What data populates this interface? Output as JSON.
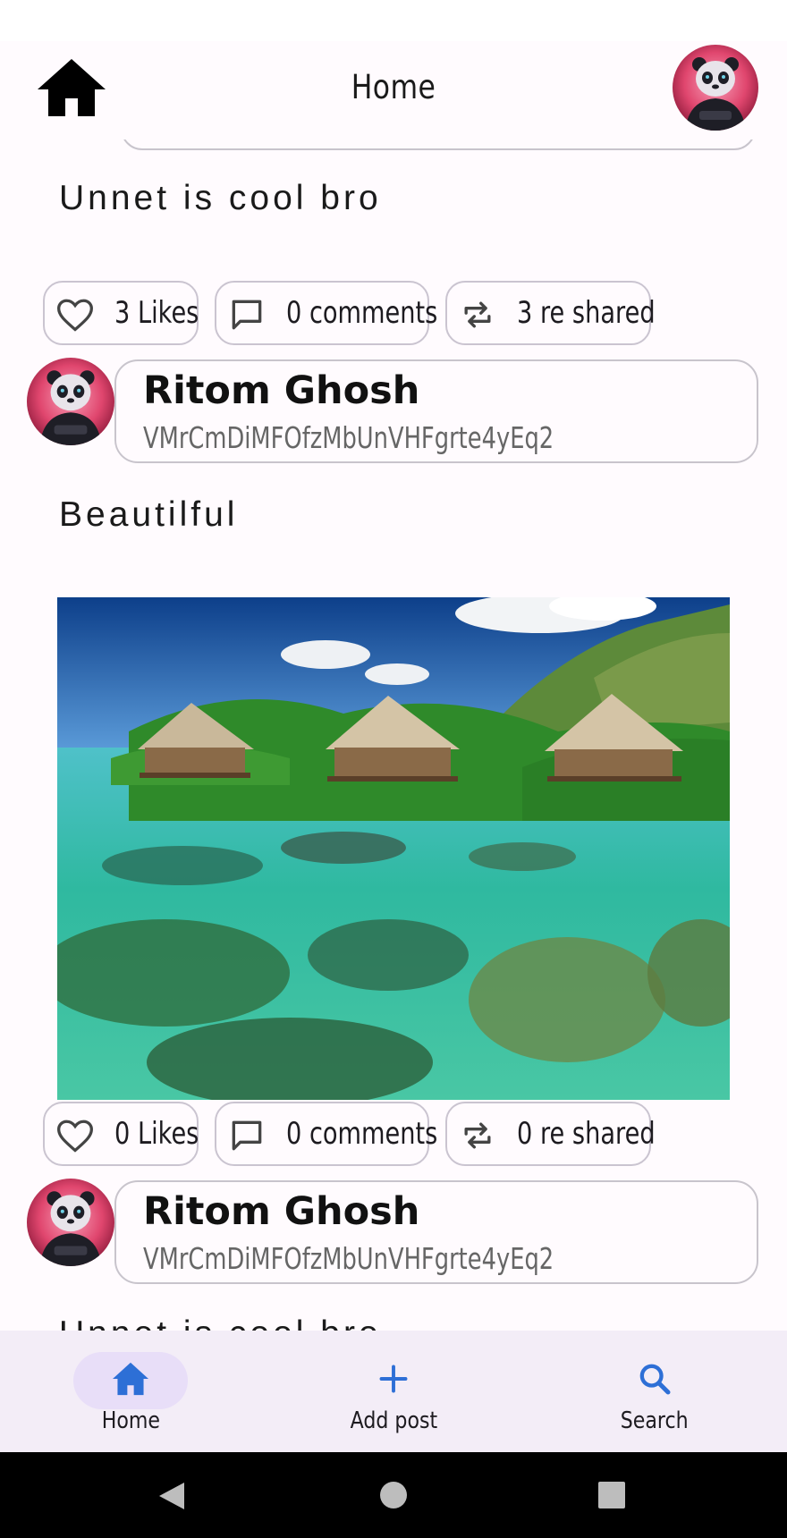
{
  "app_bar": {
    "title": "Home",
    "logo_icon": "home-icon",
    "profile_icon": "panda-avatar"
  },
  "feed": {
    "posts": [
      {
        "text": "Unnet is cool bro",
        "likes_label": "3 Likes",
        "comments_label": "0 comments",
        "reshares_label": "3 re shared"
      },
      {
        "author_name": "Ritom Ghosh",
        "author_id": "VMrCmDiMFOfzMbUnVHFgrte4yEq2",
        "text": "Beautilful",
        "likes_label": "0 Likes",
        "comments_label": "0 comments",
        "reshares_label": "0 re shared"
      },
      {
        "author_name": "Ritom Ghosh",
        "author_id": "VMrCmDiMFOfzMbUnVHFgrte4yEq2",
        "text": "Unnet is cool bro"
      }
    ]
  },
  "bottom_nav": {
    "items": [
      {
        "label": "Home",
        "icon": "home-icon",
        "selected": true
      },
      {
        "label": "Add post",
        "icon": "plus-icon",
        "selected": false
      },
      {
        "label": "Search",
        "icon": "search-icon",
        "selected": false
      }
    ]
  },
  "colors": {
    "background": "#fffbfe",
    "nav_background": "#f3edf7",
    "nav_indicator": "#e8def8",
    "accent": "#2d6fd6",
    "chip_border": "#cac4d0"
  }
}
